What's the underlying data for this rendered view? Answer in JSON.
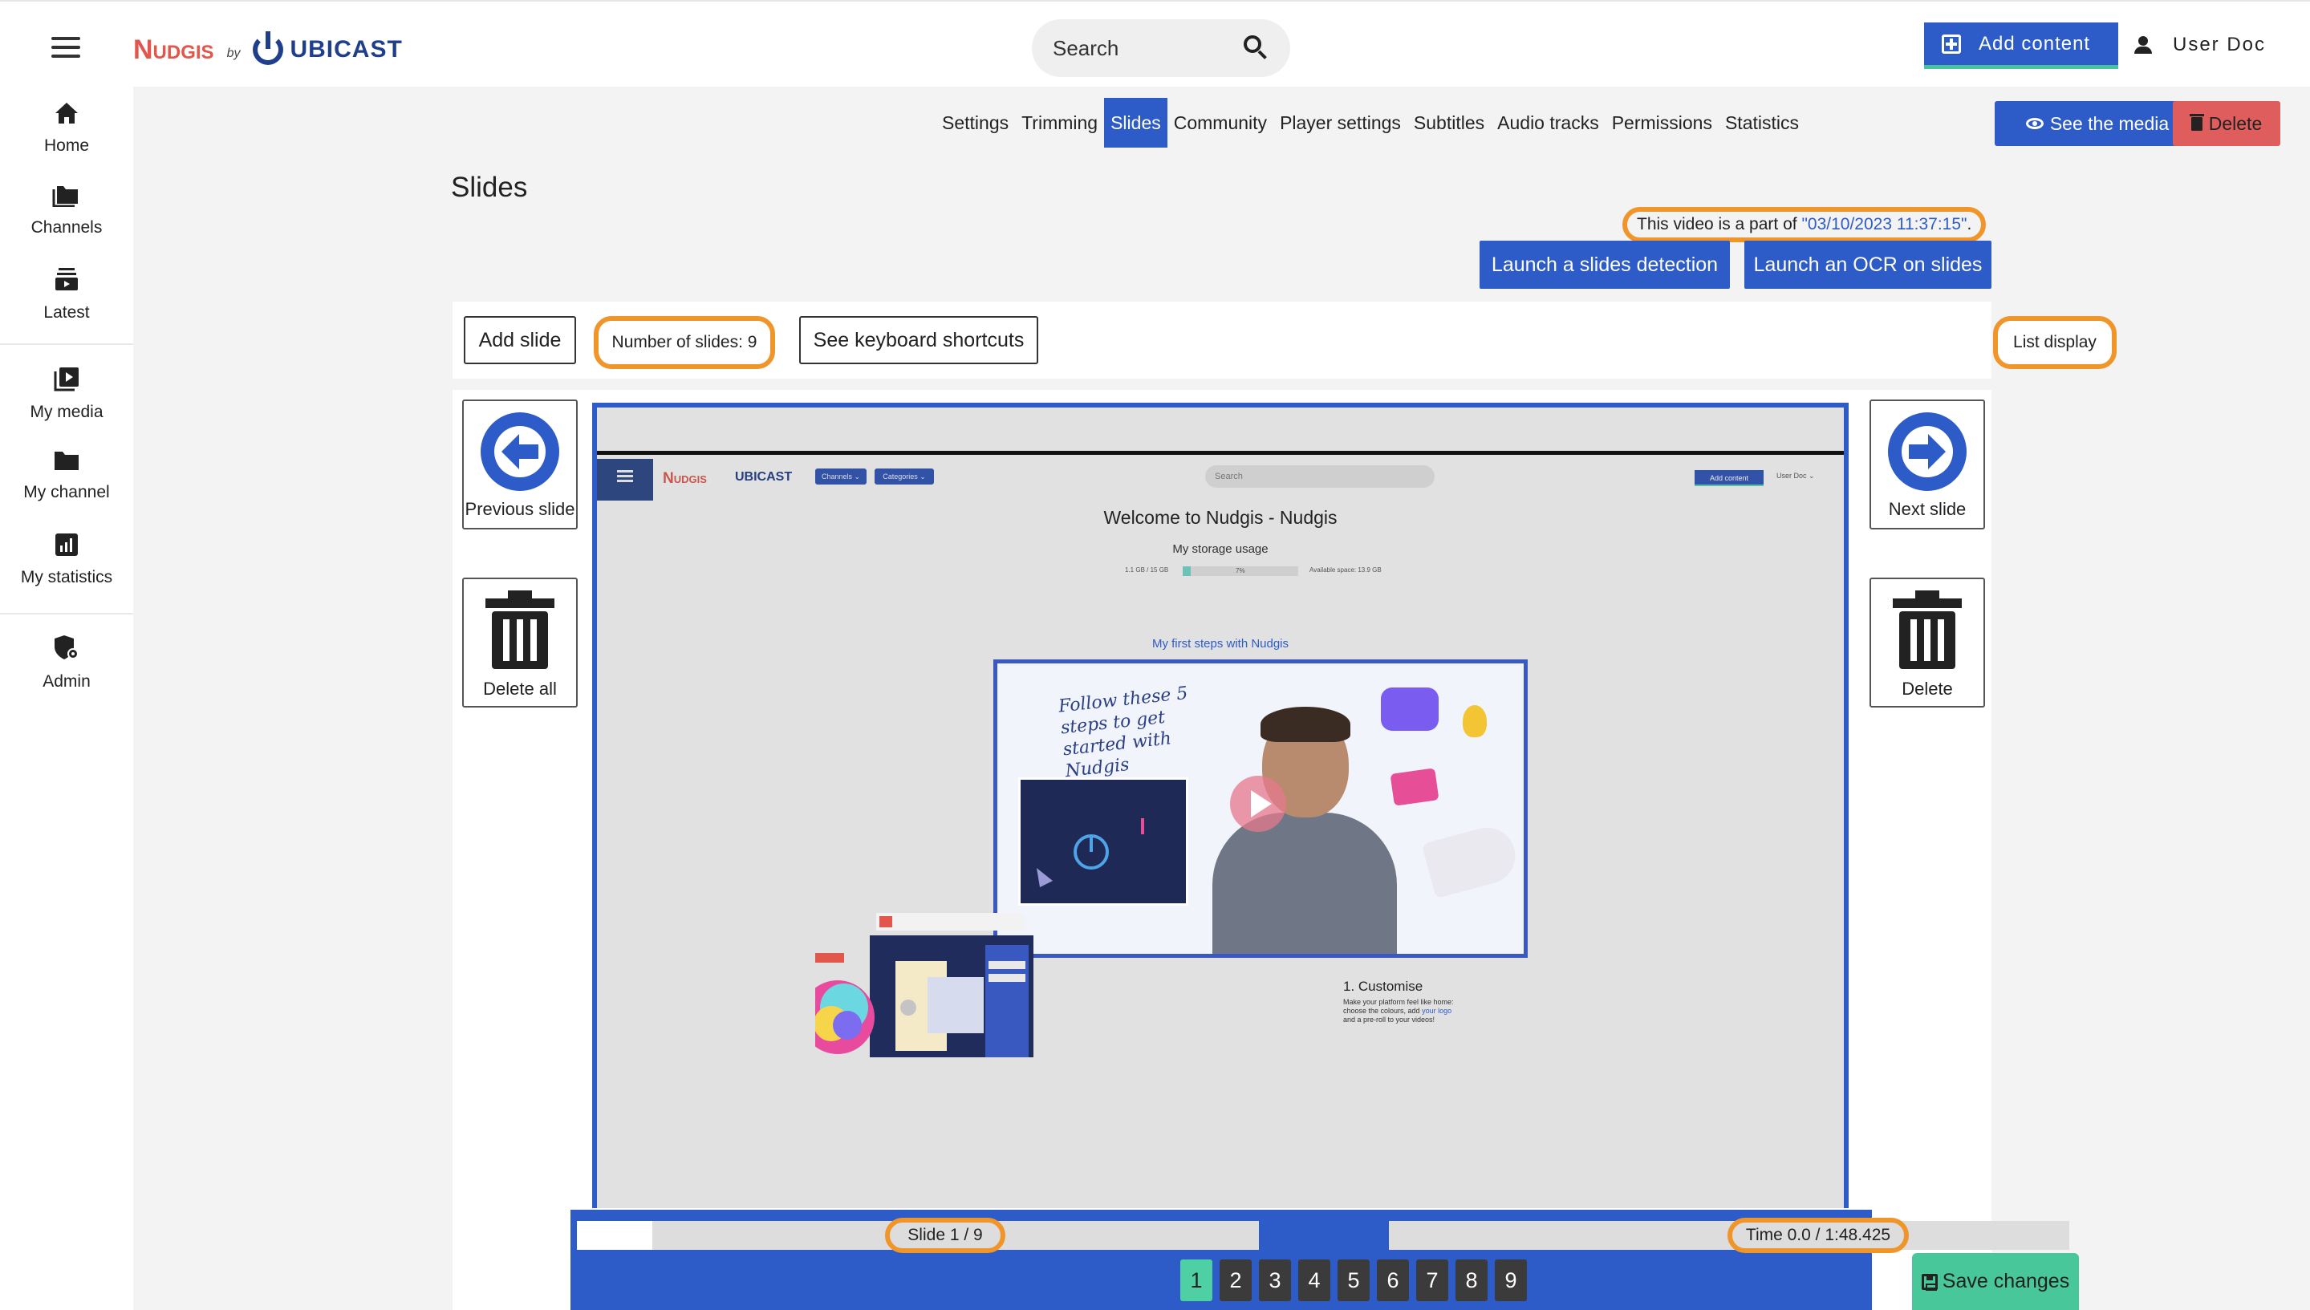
{
  "header": {
    "logo_nudgis": "Nudgis",
    "logo_by": "by",
    "logo_ubicast": "UBICAST",
    "search_placeholder": "Search",
    "add_content_label": "Add content",
    "user_name": "User Doc"
  },
  "sidebar": {
    "items": [
      {
        "label": "Home",
        "icon": "home-icon"
      },
      {
        "label": "Channels",
        "icon": "folder-icon"
      },
      {
        "label": "Latest",
        "icon": "latest-icon"
      },
      {
        "label": "My media",
        "icon": "my-media-icon"
      },
      {
        "label": "My channel",
        "icon": "folder-icon"
      },
      {
        "label": "My statistics",
        "icon": "statistics-icon"
      },
      {
        "label": "Admin",
        "icon": "admin-shield-icon"
      }
    ]
  },
  "tabs": {
    "items": [
      "Settings",
      "Trimming",
      "Slides",
      "Community",
      "Player settings",
      "Subtitles",
      "Audio tracks",
      "Permissions",
      "Statistics"
    ],
    "active": "Slides"
  },
  "actions": {
    "see_media": "See the media",
    "delete": "Delete"
  },
  "page": {
    "title": "Slides",
    "video_part_prefix": "This video is a part of ",
    "video_part_link": "\"03/10/2023 11:37:15\"",
    "video_part_suffix": ".",
    "launch_detection": "Launch a slides detection",
    "launch_ocr": "Launch an OCR on slides"
  },
  "toolbar": {
    "add_slide": "Add slide",
    "number_of_slides": "Number of slides: 9",
    "keyboard_shortcuts": "See keyboard shortcuts",
    "list_display": "List display"
  },
  "editor": {
    "previous_slide": "Previous slide",
    "next_slide": "Next slide",
    "delete_all": "Delete all",
    "delete_slide": "Delete",
    "slide_counter": "Slide 1 / 9",
    "time_counter": "Time 0.0 / 1:48.425",
    "slide_progress": 0.11,
    "pages": [
      "1",
      "2",
      "3",
      "4",
      "5",
      "6",
      "7",
      "8",
      "9"
    ],
    "active_page": "1",
    "save_changes": "Save changes"
  },
  "slide_preview": {
    "menu_label": "Menu",
    "logo": "Nudgis",
    "logo_ubicast": "UBICAST",
    "channels_chip": "Channels ⌄",
    "categories_chip": "Categories ⌄",
    "search": "Search",
    "add_content": "Add content",
    "user": "User Doc ⌄",
    "heading": "Welcome to Nudgis - Nudgis",
    "storage_title": "My storage usage",
    "storage_used": "1.1 GB / 15 GB",
    "storage_percent": "7%",
    "storage_available": "Available space: 13.9 GB",
    "steps_title": "My first steps with Nudgis",
    "thumb_text": "Follow these 5 steps to get started with Nudgis",
    "customise_title": "1. Customise",
    "customise_desc_1": "Make your platform feel like home:",
    "customise_desc_2": "choose the colours, add ",
    "customise_desc_link": "your logo",
    "customise_desc_3": "and a pre-roll to your videos!"
  },
  "colors": {
    "primary": "#2d5bc8",
    "danger": "#e05d5d",
    "highlight": "#f0952a",
    "success": "#48c79a"
  }
}
